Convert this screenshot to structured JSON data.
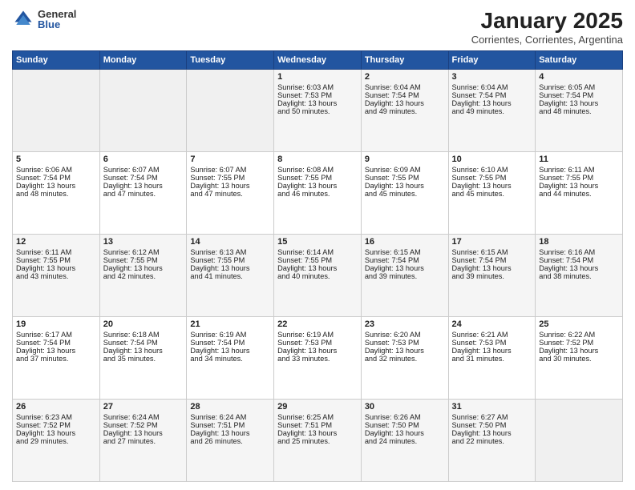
{
  "logo": {
    "general": "General",
    "blue": "Blue"
  },
  "title": "January 2025",
  "subtitle": "Corrientes, Corrientes, Argentina",
  "days_header": [
    "Sunday",
    "Monday",
    "Tuesday",
    "Wednesday",
    "Thursday",
    "Friday",
    "Saturday"
  ],
  "weeks": [
    [
      {
        "day": "",
        "info": ""
      },
      {
        "day": "",
        "info": ""
      },
      {
        "day": "",
        "info": ""
      },
      {
        "day": "1",
        "info": "Sunrise: 6:03 AM\nSunset: 7:53 PM\nDaylight: 13 hours\nand 50 minutes."
      },
      {
        "day": "2",
        "info": "Sunrise: 6:04 AM\nSunset: 7:54 PM\nDaylight: 13 hours\nand 49 minutes."
      },
      {
        "day": "3",
        "info": "Sunrise: 6:04 AM\nSunset: 7:54 PM\nDaylight: 13 hours\nand 49 minutes."
      },
      {
        "day": "4",
        "info": "Sunrise: 6:05 AM\nSunset: 7:54 PM\nDaylight: 13 hours\nand 48 minutes."
      }
    ],
    [
      {
        "day": "5",
        "info": "Sunrise: 6:06 AM\nSunset: 7:54 PM\nDaylight: 13 hours\nand 48 minutes."
      },
      {
        "day": "6",
        "info": "Sunrise: 6:07 AM\nSunset: 7:54 PM\nDaylight: 13 hours\nand 47 minutes."
      },
      {
        "day": "7",
        "info": "Sunrise: 6:07 AM\nSunset: 7:55 PM\nDaylight: 13 hours\nand 47 minutes."
      },
      {
        "day": "8",
        "info": "Sunrise: 6:08 AM\nSunset: 7:55 PM\nDaylight: 13 hours\nand 46 minutes."
      },
      {
        "day": "9",
        "info": "Sunrise: 6:09 AM\nSunset: 7:55 PM\nDaylight: 13 hours\nand 45 minutes."
      },
      {
        "day": "10",
        "info": "Sunrise: 6:10 AM\nSunset: 7:55 PM\nDaylight: 13 hours\nand 45 minutes."
      },
      {
        "day": "11",
        "info": "Sunrise: 6:11 AM\nSunset: 7:55 PM\nDaylight: 13 hours\nand 44 minutes."
      }
    ],
    [
      {
        "day": "12",
        "info": "Sunrise: 6:11 AM\nSunset: 7:55 PM\nDaylight: 13 hours\nand 43 minutes."
      },
      {
        "day": "13",
        "info": "Sunrise: 6:12 AM\nSunset: 7:55 PM\nDaylight: 13 hours\nand 42 minutes."
      },
      {
        "day": "14",
        "info": "Sunrise: 6:13 AM\nSunset: 7:55 PM\nDaylight: 13 hours\nand 41 minutes."
      },
      {
        "day": "15",
        "info": "Sunrise: 6:14 AM\nSunset: 7:55 PM\nDaylight: 13 hours\nand 40 minutes."
      },
      {
        "day": "16",
        "info": "Sunrise: 6:15 AM\nSunset: 7:54 PM\nDaylight: 13 hours\nand 39 minutes."
      },
      {
        "day": "17",
        "info": "Sunrise: 6:15 AM\nSunset: 7:54 PM\nDaylight: 13 hours\nand 39 minutes."
      },
      {
        "day": "18",
        "info": "Sunrise: 6:16 AM\nSunset: 7:54 PM\nDaylight: 13 hours\nand 38 minutes."
      }
    ],
    [
      {
        "day": "19",
        "info": "Sunrise: 6:17 AM\nSunset: 7:54 PM\nDaylight: 13 hours\nand 37 minutes."
      },
      {
        "day": "20",
        "info": "Sunrise: 6:18 AM\nSunset: 7:54 PM\nDaylight: 13 hours\nand 35 minutes."
      },
      {
        "day": "21",
        "info": "Sunrise: 6:19 AM\nSunset: 7:54 PM\nDaylight: 13 hours\nand 34 minutes."
      },
      {
        "day": "22",
        "info": "Sunrise: 6:19 AM\nSunset: 7:53 PM\nDaylight: 13 hours\nand 33 minutes."
      },
      {
        "day": "23",
        "info": "Sunrise: 6:20 AM\nSunset: 7:53 PM\nDaylight: 13 hours\nand 32 minutes."
      },
      {
        "day": "24",
        "info": "Sunrise: 6:21 AM\nSunset: 7:53 PM\nDaylight: 13 hours\nand 31 minutes."
      },
      {
        "day": "25",
        "info": "Sunrise: 6:22 AM\nSunset: 7:52 PM\nDaylight: 13 hours\nand 30 minutes."
      }
    ],
    [
      {
        "day": "26",
        "info": "Sunrise: 6:23 AM\nSunset: 7:52 PM\nDaylight: 13 hours\nand 29 minutes."
      },
      {
        "day": "27",
        "info": "Sunrise: 6:24 AM\nSunset: 7:52 PM\nDaylight: 13 hours\nand 27 minutes."
      },
      {
        "day": "28",
        "info": "Sunrise: 6:24 AM\nSunset: 7:51 PM\nDaylight: 13 hours\nand 26 minutes."
      },
      {
        "day": "29",
        "info": "Sunrise: 6:25 AM\nSunset: 7:51 PM\nDaylight: 13 hours\nand 25 minutes."
      },
      {
        "day": "30",
        "info": "Sunrise: 6:26 AM\nSunset: 7:50 PM\nDaylight: 13 hours\nand 24 minutes."
      },
      {
        "day": "31",
        "info": "Sunrise: 6:27 AM\nSunset: 7:50 PM\nDaylight: 13 hours\nand 22 minutes."
      },
      {
        "day": "",
        "info": ""
      }
    ]
  ]
}
